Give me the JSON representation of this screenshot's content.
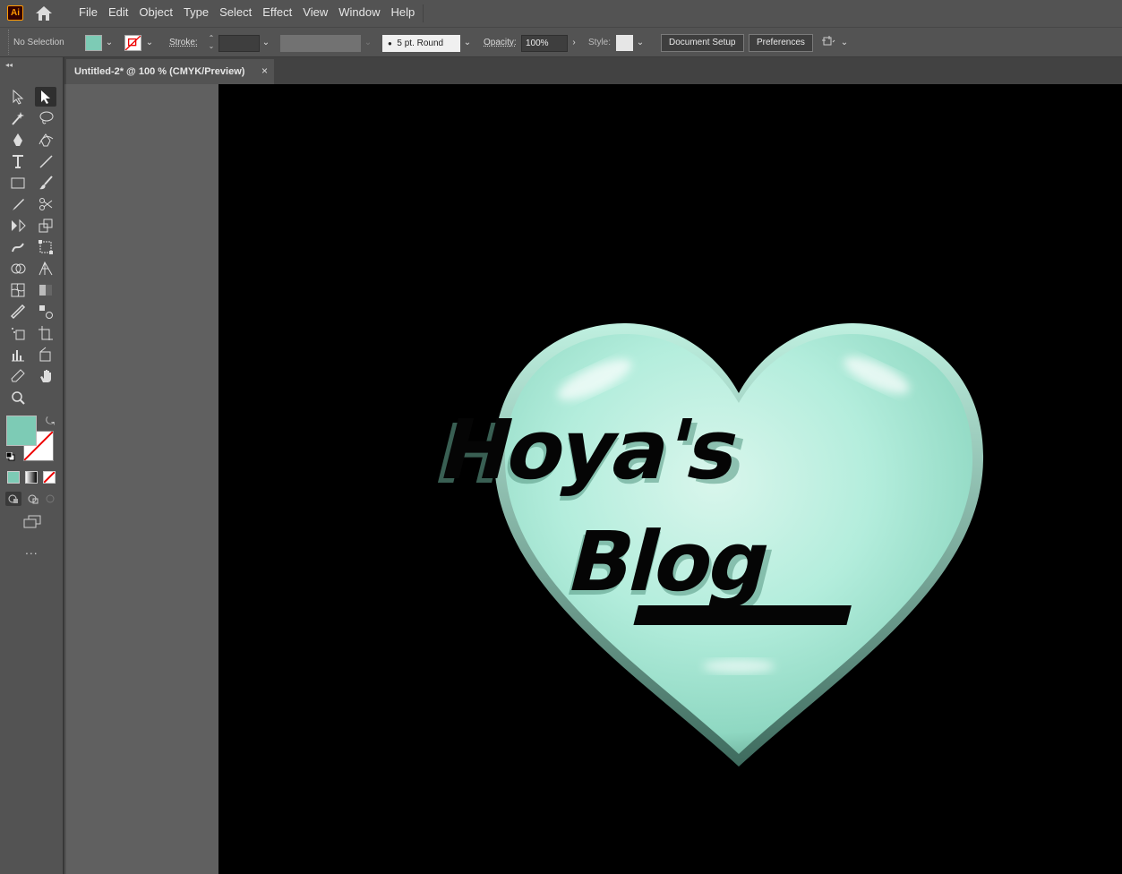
{
  "app": {
    "logo": "Ai"
  },
  "menu": [
    "File",
    "Edit",
    "Object",
    "Type",
    "Select",
    "Effect",
    "View",
    "Window",
    "Help"
  ],
  "control": {
    "selection": "No Selection",
    "fill_color": "#7dcbb5",
    "stroke_label": "Stroke:",
    "brush": "5 pt. Round",
    "opacity_label": "Opacity:",
    "opacity_value": "100%",
    "style_label": "Style:",
    "document_setup": "Document Setup",
    "preferences": "Preferences"
  },
  "document": {
    "tab_title": "Untitled-2* @ 100 % (CMYK/Preview)",
    "close": "×"
  },
  "tools": [
    "selection-tool",
    "direct-selection-tool",
    "magic-wand-tool",
    "lasso-tool",
    "pen-tool",
    "curvature-tool",
    "type-tool",
    "line-segment-tool",
    "rectangle-tool",
    "paintbrush-tool",
    "shaper-tool",
    "scissors-tool",
    "rotate-tool",
    "scale-tool",
    "warp-tool",
    "free-transform-tool",
    "shape-builder-tool",
    "perspective-grid-tool",
    "mesh-tool",
    "gradient-tool",
    "eyedropper-tool",
    "blend-tool",
    "symbol-sprayer-tool",
    "artboard-tool",
    "column-graph-tool",
    "slice-tool",
    "eraser-tool",
    "hand-tool",
    "zoom-tool"
  ],
  "more_tools": "...",
  "artwork": {
    "line1": "Hoya's",
    "line2": "Blog",
    "heart_color": "#9fe0cc"
  }
}
